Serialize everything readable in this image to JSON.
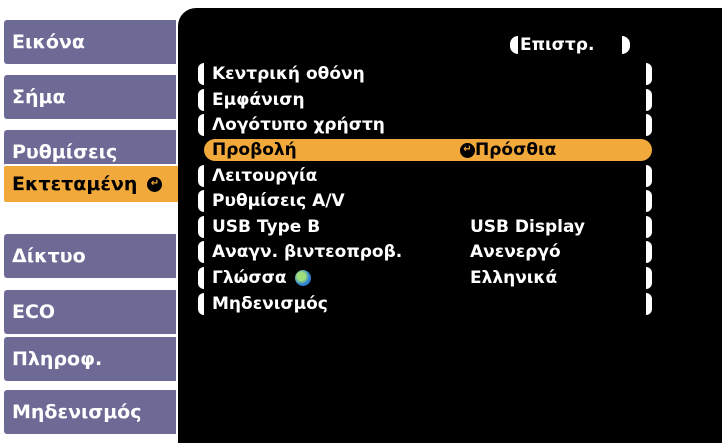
{
  "sidebar": {
    "items": [
      {
        "label": "Εικόνα"
      },
      {
        "label": "Σήμα"
      },
      {
        "label": "Ρυθμίσεις"
      },
      {
        "label": "Εκτεταμένη"
      },
      {
        "label": "Δίκτυο"
      },
      {
        "label": "ECO"
      },
      {
        "label": "Πληροφ."
      },
      {
        "label": "Μηδενισμός"
      }
    ],
    "active_index": 3,
    "active_color": "#f2a93b",
    "tab_color": "#6d6b95"
  },
  "panel": {
    "return_label": "Επιστρ.",
    "items": [
      {
        "label": "Κεντρική οθόνη",
        "value": ""
      },
      {
        "label": "Εμφάνιση",
        "value": ""
      },
      {
        "label": "Λογότυπο χρήστη",
        "value": ""
      },
      {
        "label": "Προβολή",
        "value": "Πρόσθια"
      },
      {
        "label": "Λειτουργία",
        "value": ""
      },
      {
        "label": "Ρυθμίσεις A/V",
        "value": ""
      },
      {
        "label": "USB Type B",
        "value": "USB Display"
      },
      {
        "label": "Αναγν. βιντεοπροβ.",
        "value": "Ανενεργό"
      },
      {
        "label": "Γλώσσα",
        "value": "Ελληνικά"
      },
      {
        "label": "Μηδενισμός",
        "value": ""
      }
    ],
    "selected_index": 3,
    "icons": {
      "enter": "enter-icon",
      "language": "globe-icon"
    }
  }
}
